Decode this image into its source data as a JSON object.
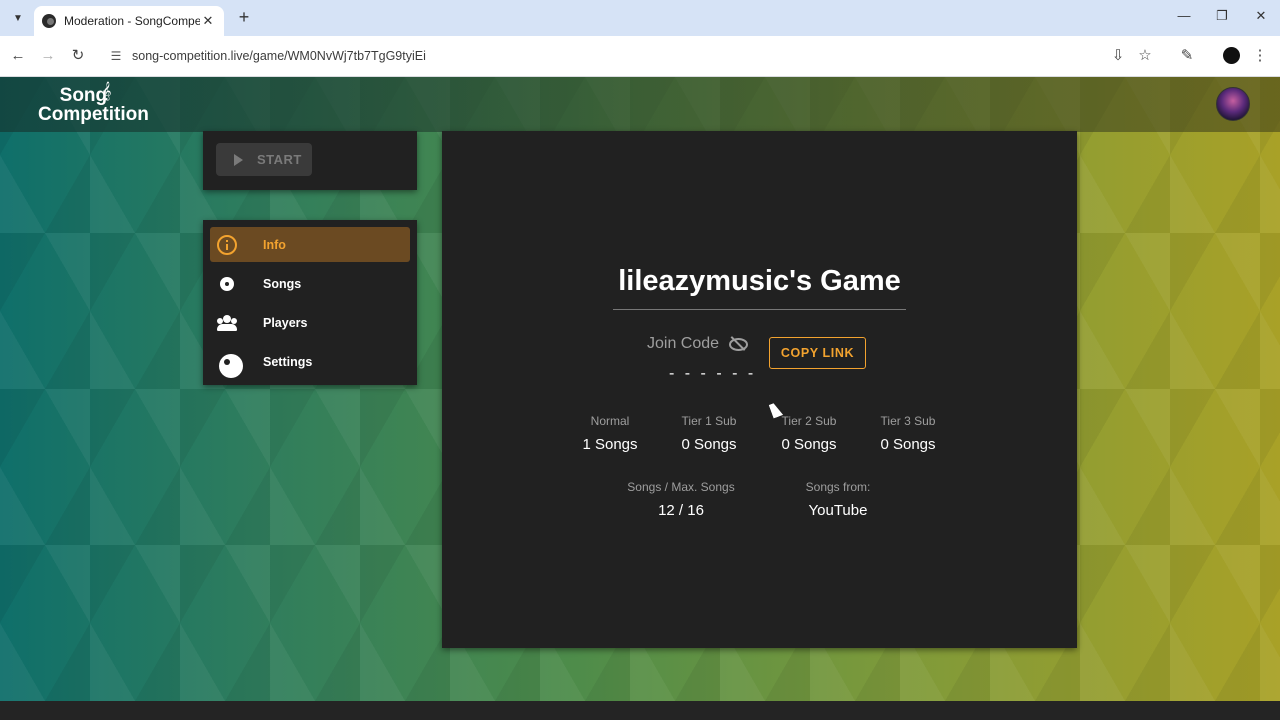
{
  "browser": {
    "tab_title": "Moderation - SongCompetition",
    "url": "song-competition.live/game/WM0NvWj7tb7TgG9tyiEi",
    "icons": [
      "tab-list-icon",
      "close-icon",
      "plus-icon",
      "minimize-icon",
      "restore-icon",
      "close-window-icon",
      "back-icon",
      "forward-icon",
      "reload-icon",
      "site-info-icon",
      "install-icon",
      "star-icon",
      "extensions-icon",
      "menu-icon"
    ]
  },
  "app": {
    "logo_line1": "Song",
    "logo_line2": "Competition"
  },
  "controls": {
    "start_label": "START"
  },
  "menu": {
    "items": [
      {
        "label": "Info",
        "icon": "info-icon",
        "active": true
      },
      {
        "label": "Songs",
        "icon": "disc-icon",
        "active": false
      },
      {
        "label": "Players",
        "icon": "people-icon",
        "active": false
      },
      {
        "label": "Settings",
        "icon": "gear-icon",
        "active": false
      }
    ]
  },
  "game": {
    "title": "lileazymusic's Game",
    "join_code_label": "Join Code",
    "join_code_value": "- - - - - -",
    "copy_link_label": "COPY LINK",
    "stats": [
      {
        "label": "Normal",
        "value": "1 Songs"
      },
      {
        "label": "Tier 1 Sub",
        "value": "0 Songs"
      },
      {
        "label": "Tier 2 Sub",
        "value": "0 Songs"
      },
      {
        "label": "Tier 3 Sub",
        "value": "0 Songs"
      }
    ],
    "songs_max_label": "Songs / Max. Songs",
    "songs_max_value": "12 / 16",
    "songs_from_label": "Songs from:",
    "songs_from_value": "YouTube"
  },
  "colors": {
    "accent": "#f3a32f",
    "active_menu_bg": "#6b4a22",
    "card_bg": "#212121"
  }
}
